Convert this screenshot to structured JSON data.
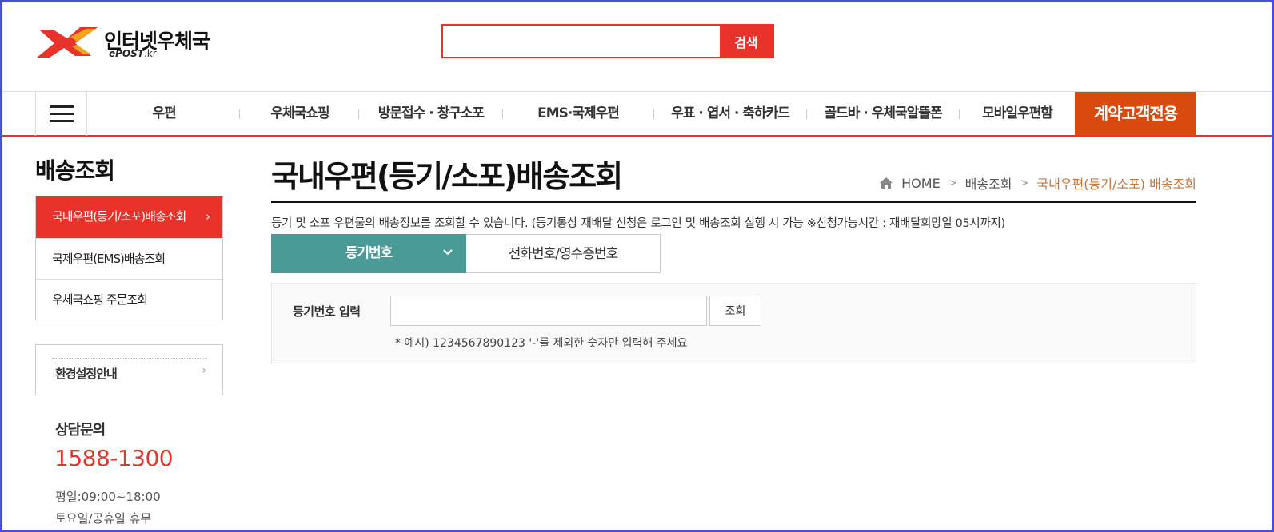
{
  "header": {
    "logo_name": "인터넷우체국",
    "logo_sub_brand": "ePOST",
    "logo_sub_tld": ".kr",
    "search_button": "검색",
    "colors": {
      "accent_red": "#e8322a",
      "contract_orange": "#d94a0f",
      "tab_teal": "#4a9a97"
    }
  },
  "nav": {
    "menu_icon": "hamburger-icon",
    "items": [
      "우편",
      "우체국쇼핑",
      "방문접수 · 창구소포",
      "EMS·국제우편",
      "우표 · 엽서 · 축하카드",
      "골드바 · 우체국알뜰폰",
      "모바일우편함"
    ],
    "contract": "계약고객전용"
  },
  "sidebar": {
    "title": "배송조회",
    "items": [
      {
        "label": "국내우편(등기/소포)배송조회",
        "active": true
      },
      {
        "label": "국제우편(EMS)배송조회",
        "active": false
      },
      {
        "label": "우체국쇼핑 주문조회",
        "active": false
      }
    ],
    "env_label": "환경설정안내",
    "cs": {
      "title": "상담문의",
      "phone": "1588-1300",
      "hours": "평일:09:00~18:00",
      "off": "토요일/공휴일 휴무"
    }
  },
  "main": {
    "title": "국내우편(등기/소포)배송조회",
    "breadcrumb": [
      "HOME",
      "배송조회",
      "국내우편(등기/소포) 배송조회"
    ],
    "description": "등기 및 소포 우편물의 배송정보를 조회할 수 있습니다. (등기통상 재배달 신청은 로그인 및 배송조회 실행 시 가능 ※신청가능시간 : 재배달희망일 05시까지)",
    "tabs": [
      {
        "label": "등기번호",
        "active": true
      },
      {
        "label": "전화번호/영수증번호",
        "active": false
      }
    ],
    "form": {
      "label": "등기번호 입력",
      "input_value": "",
      "button": "조회",
      "hint": "* 예시) 1234567890123 '-'를 제외한 숫자만 입력해 주세요"
    }
  }
}
